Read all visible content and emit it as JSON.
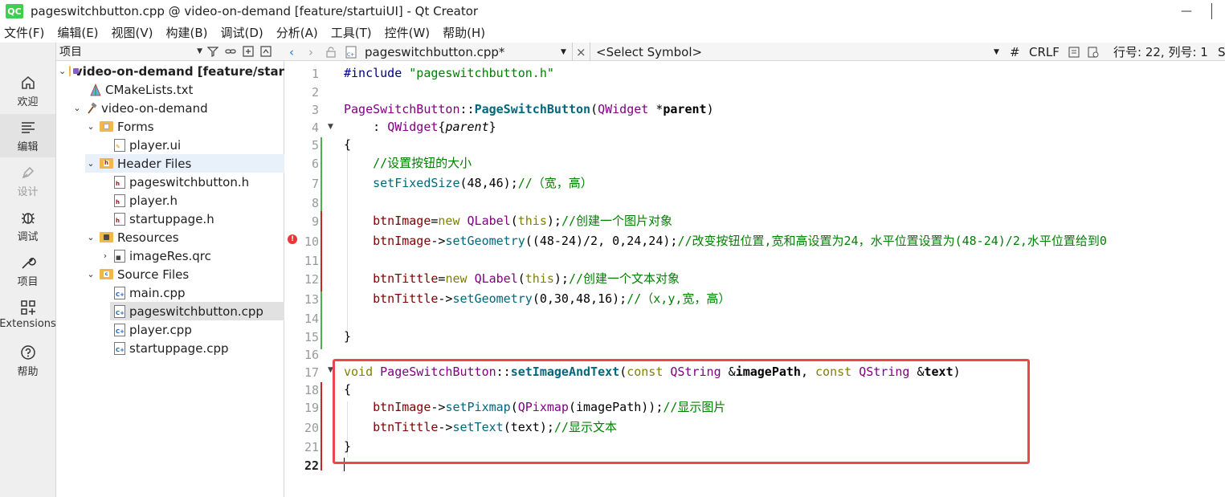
{
  "window": {
    "title": "pageswitchbutton.cpp @ video-on-demand [feature/startuiUI] - Qt Creator",
    "logo_text": "QC",
    "minimize_glyph": "—"
  },
  "menu": [
    "文件(F)",
    "编辑(E)",
    "视图(V)",
    "构建(B)",
    "调试(D)",
    "分析(A)",
    "工具(T)",
    "控件(W)",
    "帮助(H)"
  ],
  "modes": [
    {
      "label": "欢迎",
      "icon": "home-icon"
    },
    {
      "label": "编辑",
      "icon": "edit-lines-icon"
    },
    {
      "label": "设计",
      "icon": "pen-icon"
    },
    {
      "label": "调试",
      "icon": "bug-icon"
    },
    {
      "label": "项目",
      "icon": "wrench-icon"
    },
    {
      "label": "Extensions",
      "icon": "extensions-grid-icon"
    },
    {
      "label": "帮助",
      "icon": "help-icon"
    }
  ],
  "project_panel": {
    "combo_label": "项目",
    "tree": [
      {
        "label": "video-on-demand [feature/star",
        "bold": true
      },
      {
        "label": "CMakeLists.txt"
      },
      {
        "label": "video-on-demand"
      },
      {
        "label": "Forms"
      },
      {
        "label": "player.ui"
      },
      {
        "label": "Header Files"
      },
      {
        "label": "pageswitchbutton.h"
      },
      {
        "label": "player.h"
      },
      {
        "label": "startuppage.h"
      },
      {
        "label": "Resources"
      },
      {
        "label": "imageRes.qrc"
      },
      {
        "label": "Source Files"
      },
      {
        "label": "main.cpp"
      },
      {
        "label": "pageswitchbutton.cpp"
      },
      {
        "label": "player.cpp"
      },
      {
        "label": "startuppage.cpp"
      }
    ]
  },
  "editor_toolbar": {
    "file_name": "pageswitchbutton.cpp*",
    "symbol": "<Select Symbol>",
    "hash": "#",
    "line_ending": "CRLF",
    "position": "行号: 22, 列号: 1",
    "close_glyph": "×",
    "trailing": "S"
  },
  "line_numbers": [
    "1",
    "2",
    "3",
    "4",
    "5",
    "6",
    "7",
    "8",
    "9",
    "10",
    "11",
    "12",
    "13",
    "14",
    "15",
    "16",
    "17",
    "18",
    "19",
    "20",
    "21",
    "22"
  ],
  "code": {
    "l1": [
      "#include ",
      "\"pageswitchbutton.h\""
    ],
    "l3": [
      "PageSwitchButton",
      "::",
      "PageSwitchButton",
      "(",
      "QWidget",
      " *",
      "parent",
      ")"
    ],
    "l4": [
      "    : ",
      "QWidget",
      "{",
      "parent",
      "}"
    ],
    "l5": "{",
    "l6": "    //设置按钮的大小",
    "l7": [
      "    ",
      "setFixedSize",
      "(48,46);",
      "//（宽，高）"
    ],
    "l9": [
      "    ",
      "btnImage",
      "=",
      "new",
      " ",
      "QLabel",
      "(",
      "this",
      ");",
      "//创建一个图片对象"
    ],
    "l10": [
      "    ",
      "btnImage",
      "->",
      "setGeometry",
      "((48-24)/2, 0,24,24);",
      "//改变按钮位置,宽和高设置为24，水平位置设置为(48-24)/2,水平位置给到0"
    ],
    "l12": [
      "    ",
      "btnTittle",
      "=",
      "new",
      " ",
      "QLabel",
      "(",
      "this",
      ");",
      "//创建一个文本对象"
    ],
    "l13": [
      "    ",
      "btnTittle",
      "->",
      "setGeometry",
      "(0,30,48,16);",
      "//（x,y,宽，高）"
    ],
    "l15": "}",
    "l17": [
      "void",
      " ",
      "PageSwitchButton",
      "::",
      "setImageAndText",
      "(",
      "const",
      " ",
      "QString",
      " &",
      "imagePath",
      ", ",
      "const",
      " ",
      "QString",
      " &",
      "text",
      ")"
    ],
    "l18": "{",
    "l19": [
      "    ",
      "btnImage",
      "->",
      "setPixmap",
      "(",
      "QPixmap",
      "(",
      "imagePath",
      "));",
      "//显示图片"
    ],
    "l20": [
      "    ",
      "btnTittle",
      "->",
      "setText",
      "(",
      "text",
      ");",
      "//显示文本"
    ],
    "l21": "}"
  },
  "colors": {
    "highlight_box": "#e9464e",
    "keyword": "#808000",
    "type": "#800080",
    "function": "#00677c",
    "member": "#800000",
    "comment": "#008000",
    "string": "#008000"
  }
}
